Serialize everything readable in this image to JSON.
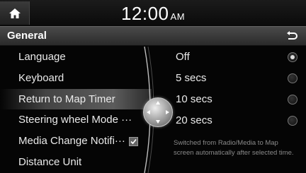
{
  "status_bar": {
    "time": "12:00",
    "ampm": "AM",
    "home_icon": "home-icon"
  },
  "header": {
    "title": "General",
    "back_icon": "back-arrow-icon"
  },
  "menu": {
    "items": [
      {
        "label": "Language"
      },
      {
        "label": "Keyboard"
      },
      {
        "label": "Return to Map Timer",
        "selected": true
      },
      {
        "label": "Steering wheel Mode ···"
      },
      {
        "label": "Media Change Notifi···",
        "checkbox": true,
        "checked": true
      },
      {
        "label": "Distance Unit"
      }
    ]
  },
  "options": {
    "items": [
      {
        "label": "Off",
        "selected": true
      },
      {
        "label": "5 secs",
        "selected": false
      },
      {
        "label": "10 secs",
        "selected": false
      },
      {
        "label": "20 secs",
        "selected": false
      }
    ],
    "help_text": "Switched from Radio/Media to Map screen automatically after selected time."
  },
  "colors": {
    "background": "#050505",
    "header": "#3a3a3a",
    "help_text": "#8a8a8a"
  }
}
